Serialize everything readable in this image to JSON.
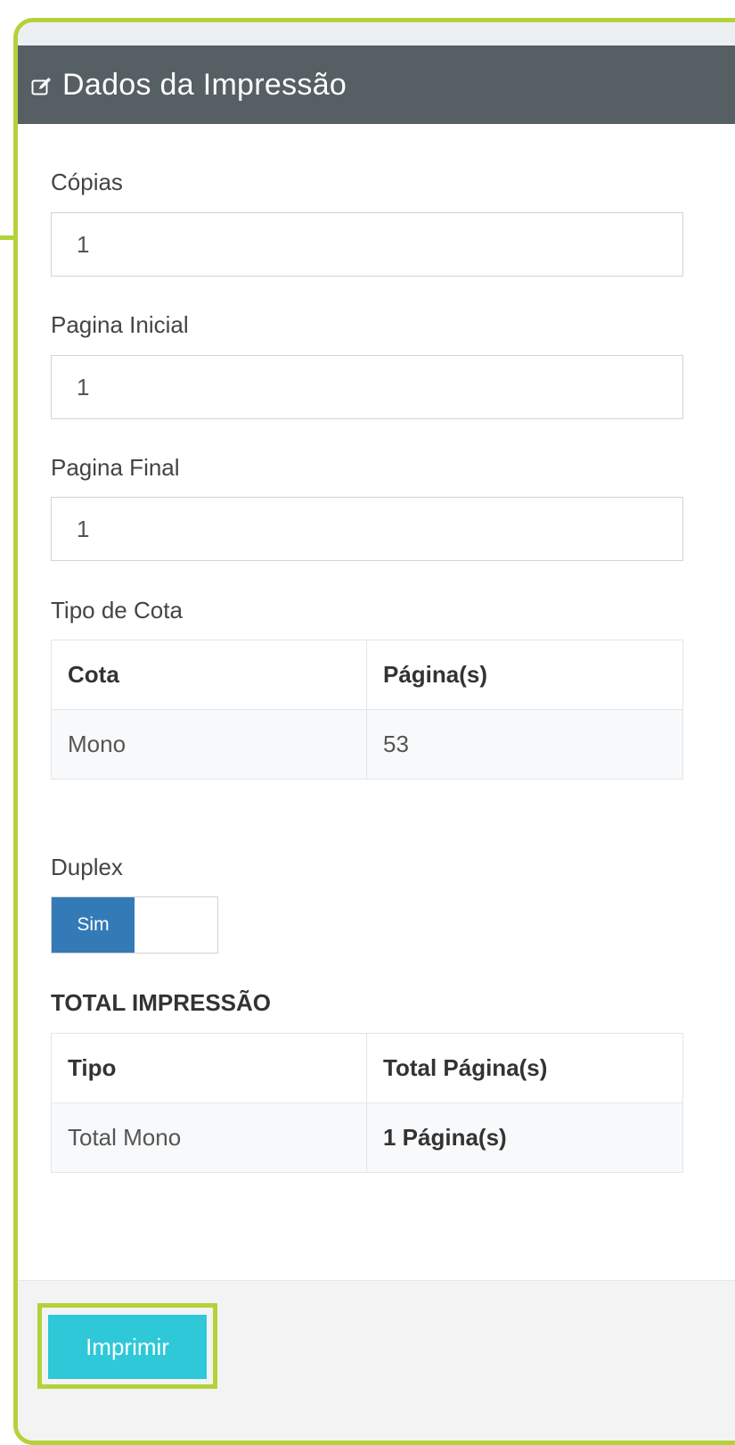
{
  "panel": {
    "title": "Dados da Impressão",
    "title_icon": "edit-icon"
  },
  "fields": {
    "copies": {
      "label": "Cópias",
      "value": "1"
    },
    "start_page": {
      "label": "Pagina Inicial",
      "value": "1"
    },
    "end_page": {
      "label": "Pagina Final",
      "value": "1"
    }
  },
  "quota": {
    "label": "Tipo de Cota",
    "headers": [
      "Cota",
      "Página(s)"
    ],
    "rows": [
      [
        "Mono",
        "53"
      ]
    ]
  },
  "duplex": {
    "label": "Duplex",
    "option_label": "Sim",
    "enabled": true
  },
  "total": {
    "heading": "TOTAL IMPRESSÃO",
    "headers": [
      "Tipo",
      "Total Página(s)"
    ],
    "rows": [
      [
        "Total Mono",
        "1 Página(s)"
      ]
    ]
  },
  "footer": {
    "print_label": "Imprimir"
  },
  "colors": {
    "accent_highlight": "#b3d23a",
    "header_bg": "#565f63",
    "toggle_on": "#337ab7",
    "print_button": "#2ec8d8"
  }
}
